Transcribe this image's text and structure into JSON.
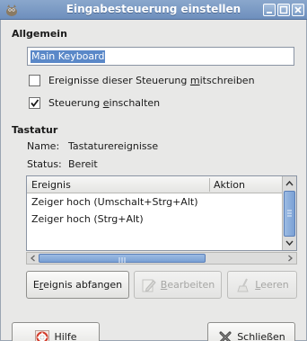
{
  "window": {
    "title": "Eingabesteuerung einstellen",
    "controls": [
      "minimize-icon",
      "maximize-icon",
      "close-icon"
    ]
  },
  "general": {
    "heading": "Allgemein",
    "name_value": "Main Keyboard",
    "checkbox_log": {
      "label_pre": "Ereignisse dieser Steuerung ",
      "label_ul": "m",
      "label_post": "itschreiben",
      "checked": false
    },
    "checkbox_enable": {
      "label_pre": "Steuerung ",
      "label_ul": "e",
      "label_post": "inschalten",
      "checked": true
    }
  },
  "keyboard": {
    "heading": "Tastatur",
    "name_label": "Name:",
    "name_value": "Tastaturereignisse",
    "status_label": "Status:",
    "status_value": "Bereit",
    "columns": [
      "Ereignis",
      "Aktion"
    ],
    "rows": [
      {
        "event": "Zeiger hoch (Umschalt+Strg+Alt)",
        "action": ""
      },
      {
        "event": "Zeiger hoch (Strg+Alt)",
        "action": ""
      }
    ]
  },
  "buttons": {
    "capture": {
      "pre": "E",
      "ul": "r",
      "post": "eignis abfangen"
    },
    "edit": {
      "pre": "",
      "ul": "B",
      "post": "earbeiten"
    },
    "clear": {
      "pre": "",
      "ul": "L",
      "post": "eeren"
    },
    "help": {
      "pre": "",
      "ul": "H",
      "post": "ilfe"
    },
    "close": {
      "pre": "Sc",
      "ul": "h",
      "post": "ließen"
    }
  },
  "colors": {
    "titlebar": "#7b9bc6",
    "selection": "#5a88c8",
    "scroll_thumb": "#8caed9"
  }
}
